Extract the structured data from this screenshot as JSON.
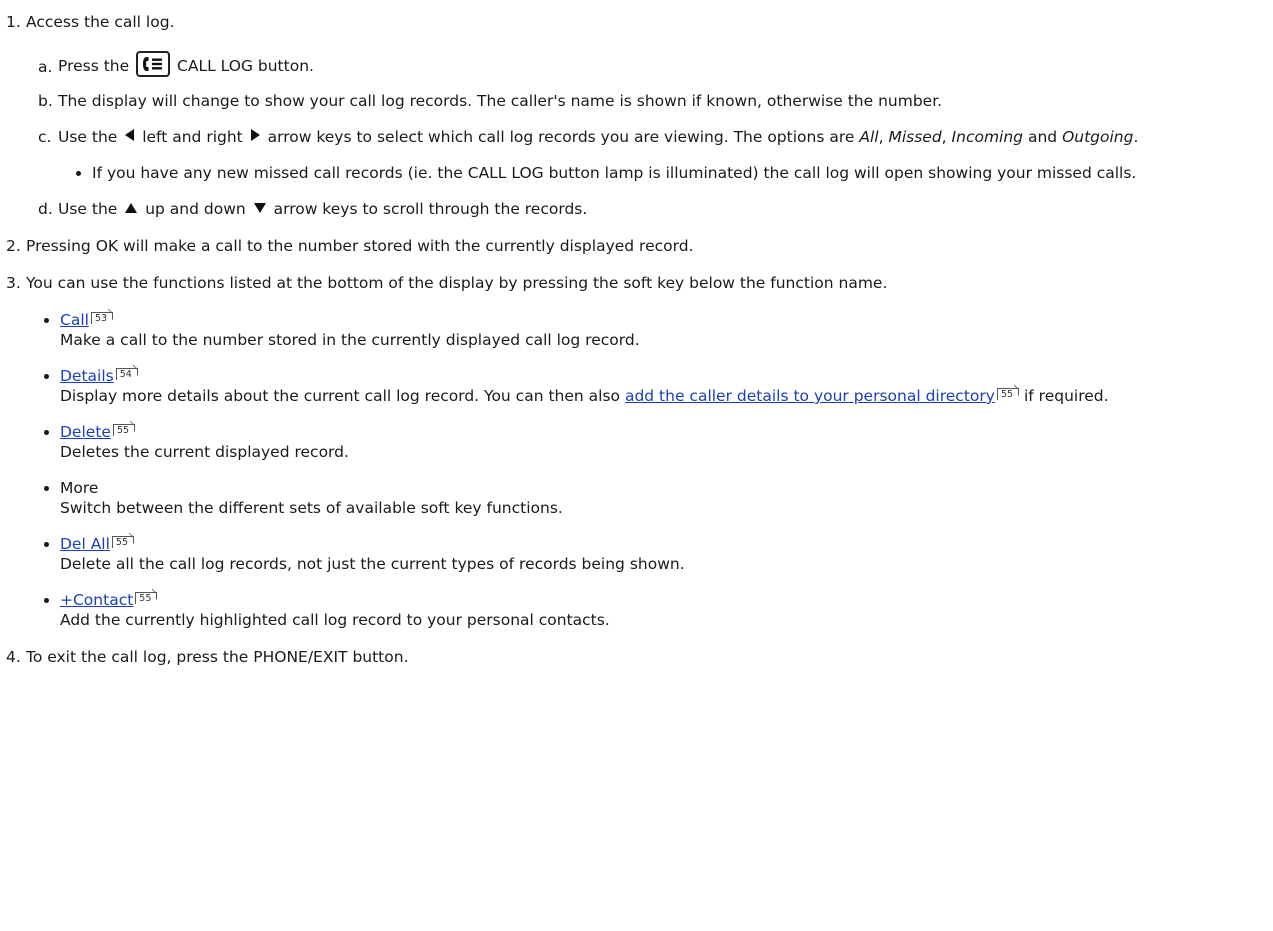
{
  "steps": [
    {
      "num": "1.",
      "text": "Access the call log."
    },
    {
      "num": "2.",
      "text": "Pressing OK will make a call to the number stored with the currently displayed record."
    },
    {
      "num": "3.",
      "text": "You can use the functions listed at the bottom of the display by pressing the soft key below the function name."
    },
    {
      "num": "4.",
      "text": "To exit the call log, press the PHONE/EXIT button."
    }
  ],
  "substeps": {
    "a": {
      "letter": "a.",
      "pre": "Press the",
      "post": "CALL LOG button."
    },
    "b": {
      "letter": "b.",
      "text": "The display will change to show your call log records. The caller's name is shown if known, otherwise the number."
    },
    "c": {
      "letter": "c.",
      "pre": "Use the",
      "mid": "left and right",
      "post1": "arrow keys to select which call log records you are viewing. The options are",
      "opt_all": "All",
      "comma1": ",",
      "opt_missed": "Missed",
      "comma2": ",",
      "opt_incoming": "Incoming",
      "and": "and",
      "opt_outgoing": "Outgoing",
      "period": "."
    },
    "c_bullet": "If you have any new missed call records (ie. the CALL LOG button lamp is illuminated) the call log will open showing your missed calls.",
    "d": {
      "letter": "d.",
      "pre": "Use the",
      "mid": "up and down",
      "post": "arrow keys to scroll through the records."
    }
  },
  "functions": {
    "call": {
      "label": "Call",
      "page": "53",
      "desc": "Make a call to the number stored in the currently displayed call log record."
    },
    "details": {
      "label": "Details",
      "page": "54",
      "desc_pre": "Display more details about the current call log record. You can then also",
      "desc_link": "add the caller details to your personal directory",
      "desc_link_page": "55",
      "desc_post": "if required."
    },
    "delete": {
      "label": "Delete",
      "page": "55",
      "desc": "Deletes the current displayed record."
    },
    "more": {
      "label": "More",
      "desc": "Switch between the different sets of available soft key functions."
    },
    "del_all": {
      "label": "Del All",
      "page": "55",
      "desc": "Delete all the call log records, not just the current types of records being shown."
    },
    "contact": {
      "label": "+Contact",
      "page": "55",
      "desc": "Add the currently highlighted call log record to your personal contacts."
    }
  },
  "icons": {
    "call_log_button": "call-log-button-icon",
    "left_arrow": "left-arrow-icon",
    "right_arrow": "right-arrow-icon",
    "up_arrow": "up-arrow-icon",
    "down_arrow": "down-arrow-icon",
    "page_ref": "page-reference-icon"
  },
  "colors": {
    "link": "#1a3fb8",
    "text": "#1a1a1a"
  }
}
